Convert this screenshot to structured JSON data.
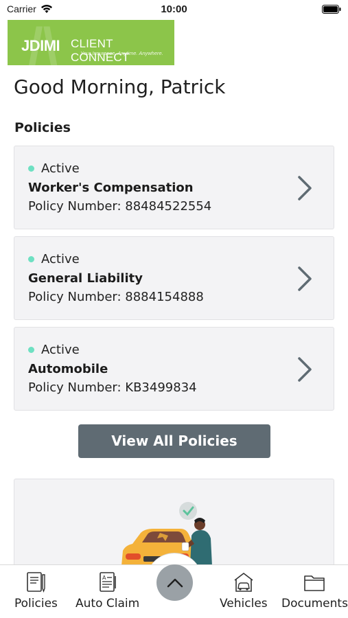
{
  "status_bar": {
    "carrier": "Carrier",
    "time": "10:00"
  },
  "logo": {
    "brand": "JDIMI",
    "product": "CLIENT CONNECT",
    "tagline": "Your Insurance. Anytime. Anywhere."
  },
  "greeting": "Good Morning, Patrick",
  "policies_section": {
    "title": "Policies",
    "items": [
      {
        "status": "Active",
        "name": "Worker's Compensation",
        "number_label": "Policy Number: 88484522554"
      },
      {
        "status": "Active",
        "name": "General Liability",
        "number_label": "Policy Number: 8884154888"
      },
      {
        "status": "Active",
        "name": "Automobile",
        "number_label": "Policy Number: KB3499834"
      }
    ],
    "view_all_label": "View All Policies"
  },
  "bottom_nav": {
    "items": [
      {
        "label": "Policies",
        "icon": "policy-document-icon"
      },
      {
        "label": "Auto Claim",
        "icon": "auto-claim-icon"
      },
      {
        "label": "Vehicles",
        "icon": "vehicle-garage-icon"
      },
      {
        "label": "Documents",
        "icon": "folder-icon"
      }
    ],
    "expand_icon": "chevron-up-icon"
  },
  "colors": {
    "brand_green": "#8cc54a",
    "active_dot": "#6ee0c2",
    "button": "#5f6b73",
    "card_bg": "#f3f3f5"
  }
}
